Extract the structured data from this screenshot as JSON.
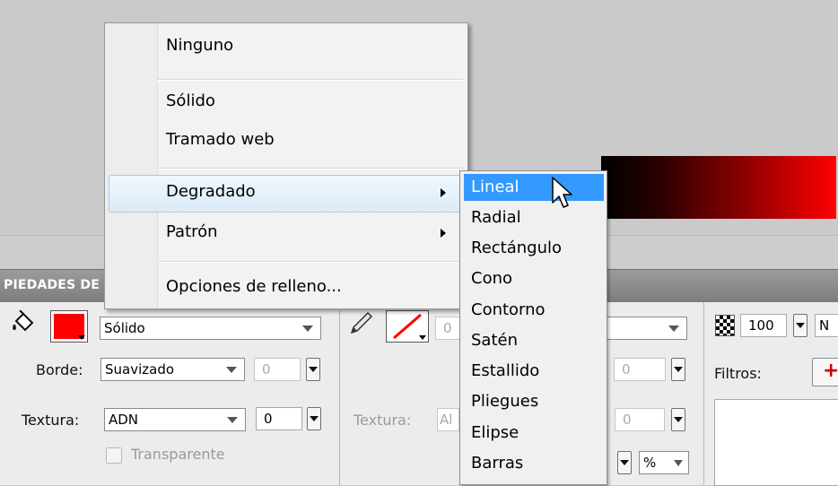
{
  "panel": {
    "title": "PIEDADES DE",
    "fill_type": "Sólido",
    "fill_color": "#ff0000",
    "edge_label": "Borde:",
    "edge_value": "Suavizado",
    "edge_num": "0",
    "texture_label": "Textura:",
    "texture_value": "ADN",
    "texture_num": "0",
    "transparent_label": "Transparente",
    "stroke_num": "0",
    "stroke_texture_label": "Textura:",
    "stroke_texture_value": "Al",
    "stroke_num2": "0",
    "stroke_num3": "0",
    "percent_value": "%",
    "opacity": "100",
    "blend_value": "N",
    "filters_label": "Filtros:",
    "add_filter": "+"
  },
  "menu": {
    "items": [
      {
        "label": "Ninguno"
      },
      {
        "label": "Sólido"
      },
      {
        "label": "Tramado web"
      },
      {
        "label": "Degradado"
      },
      {
        "label": "Patrón"
      },
      {
        "label": "Opciones de relleno..."
      }
    ]
  },
  "submenu": {
    "items": [
      {
        "label": "Lineal"
      },
      {
        "label": "Radial"
      },
      {
        "label": "Rectángulo"
      },
      {
        "label": "Cono"
      },
      {
        "label": "Contorno"
      },
      {
        "label": "Satén"
      },
      {
        "label": "Estallido"
      },
      {
        "label": "Pliegues"
      },
      {
        "label": "Elipse"
      },
      {
        "label": "Barras"
      }
    ]
  },
  "colors": {
    "highlight": "#3399ff",
    "gradient_start": "#000000",
    "gradient_end": "#ff0000"
  }
}
